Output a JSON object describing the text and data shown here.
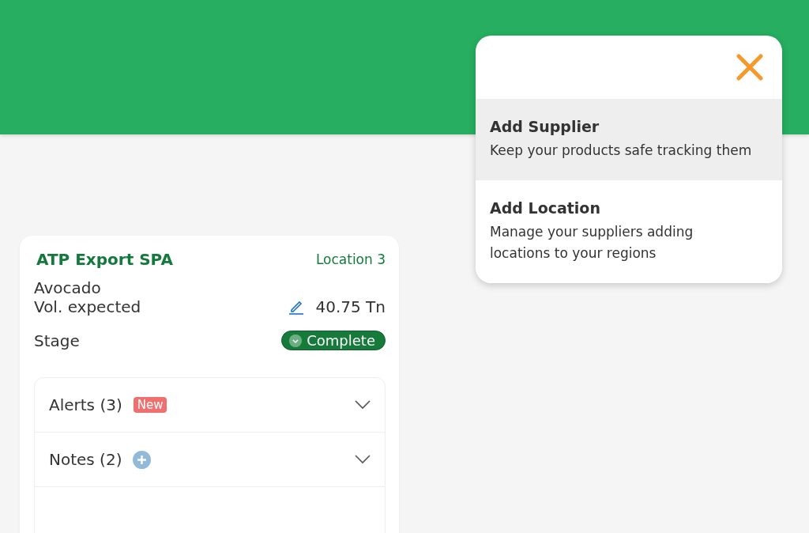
{
  "menu": {
    "items": [
      {
        "title": "Add Supplier",
        "description": "Keep your products safe tracking them",
        "selected": true
      },
      {
        "title": "Add Location",
        "description": "Manage your suppliers adding locations to your regions",
        "selected": false
      }
    ]
  },
  "card": {
    "title": "ATP Export SPA",
    "location": "Location 3",
    "product": "Avocado",
    "volume_label": "Vol. expected",
    "volume": "40.75 Tn",
    "stage_label": "Stage",
    "stage": "Complete",
    "sections": [
      {
        "kind": "badge",
        "label": "Alerts (3)",
        "badge": "New",
        "expanded": false
      },
      {
        "kind": "add",
        "label": "Notes (2)",
        "expanded": false
      }
    ]
  }
}
